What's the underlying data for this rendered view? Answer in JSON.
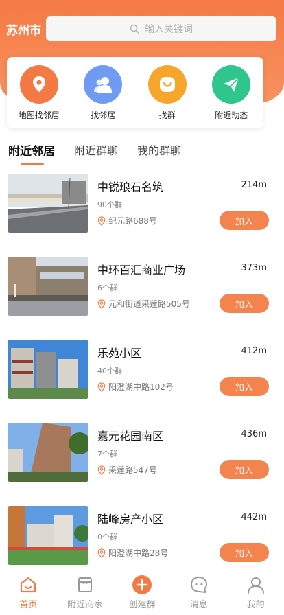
{
  "header": {
    "city": "苏州市",
    "search_placeholder": "输入关键词"
  },
  "quick_actions": [
    {
      "label": "地图找邻居",
      "icon": "map-pin-icon",
      "color": "#f47a45"
    },
    {
      "label": "找邻居",
      "icon": "neighbors-icon",
      "color": "#6f9cf2"
    },
    {
      "label": "找群",
      "icon": "smile-icon",
      "color": "#f7a62c"
    },
    {
      "label": "附近动态",
      "icon": "paper-plane-icon",
      "color": "#2fc68d"
    }
  ],
  "tabs": [
    {
      "label": "附近邻居",
      "active": true
    },
    {
      "label": "附近群聊",
      "active": false
    },
    {
      "label": "我的群聊",
      "active": false
    }
  ],
  "items": [
    {
      "name": "中锐琅石名筑",
      "distance": "214m",
      "groups": "90个群",
      "address": "纪元路688号",
      "join": "加入"
    },
    {
      "name": "中环百汇商业广场",
      "distance": "373m",
      "groups": "6个群",
      "address": "元和街道采莲路505号",
      "join": "加入"
    },
    {
      "name": "乐苑小区",
      "distance": "412m",
      "groups": "40个群",
      "address": "阳澄湖中路102号",
      "join": "加入"
    },
    {
      "name": "嘉元花园南区",
      "distance": "436m",
      "groups": "7个群",
      "address": "采莲路547号",
      "join": "加入"
    },
    {
      "name": "陆峰房产小区",
      "distance": "442m",
      "groups": "0个群",
      "address": "阳澄湖中路28号",
      "join": "加入"
    }
  ],
  "bottom_nav": [
    {
      "label": "首页",
      "icon": "home-icon",
      "active": true
    },
    {
      "label": "附近商家",
      "icon": "store-icon",
      "active": false
    },
    {
      "label": "创建群",
      "icon": "plus-circle-icon",
      "active": false
    },
    {
      "label": "消息",
      "icon": "message-icon",
      "active": false
    },
    {
      "label": "我的",
      "icon": "profile-icon",
      "active": false
    }
  ],
  "colors": {
    "accent": "#f47a45",
    "join_button": "#f3844e"
  }
}
